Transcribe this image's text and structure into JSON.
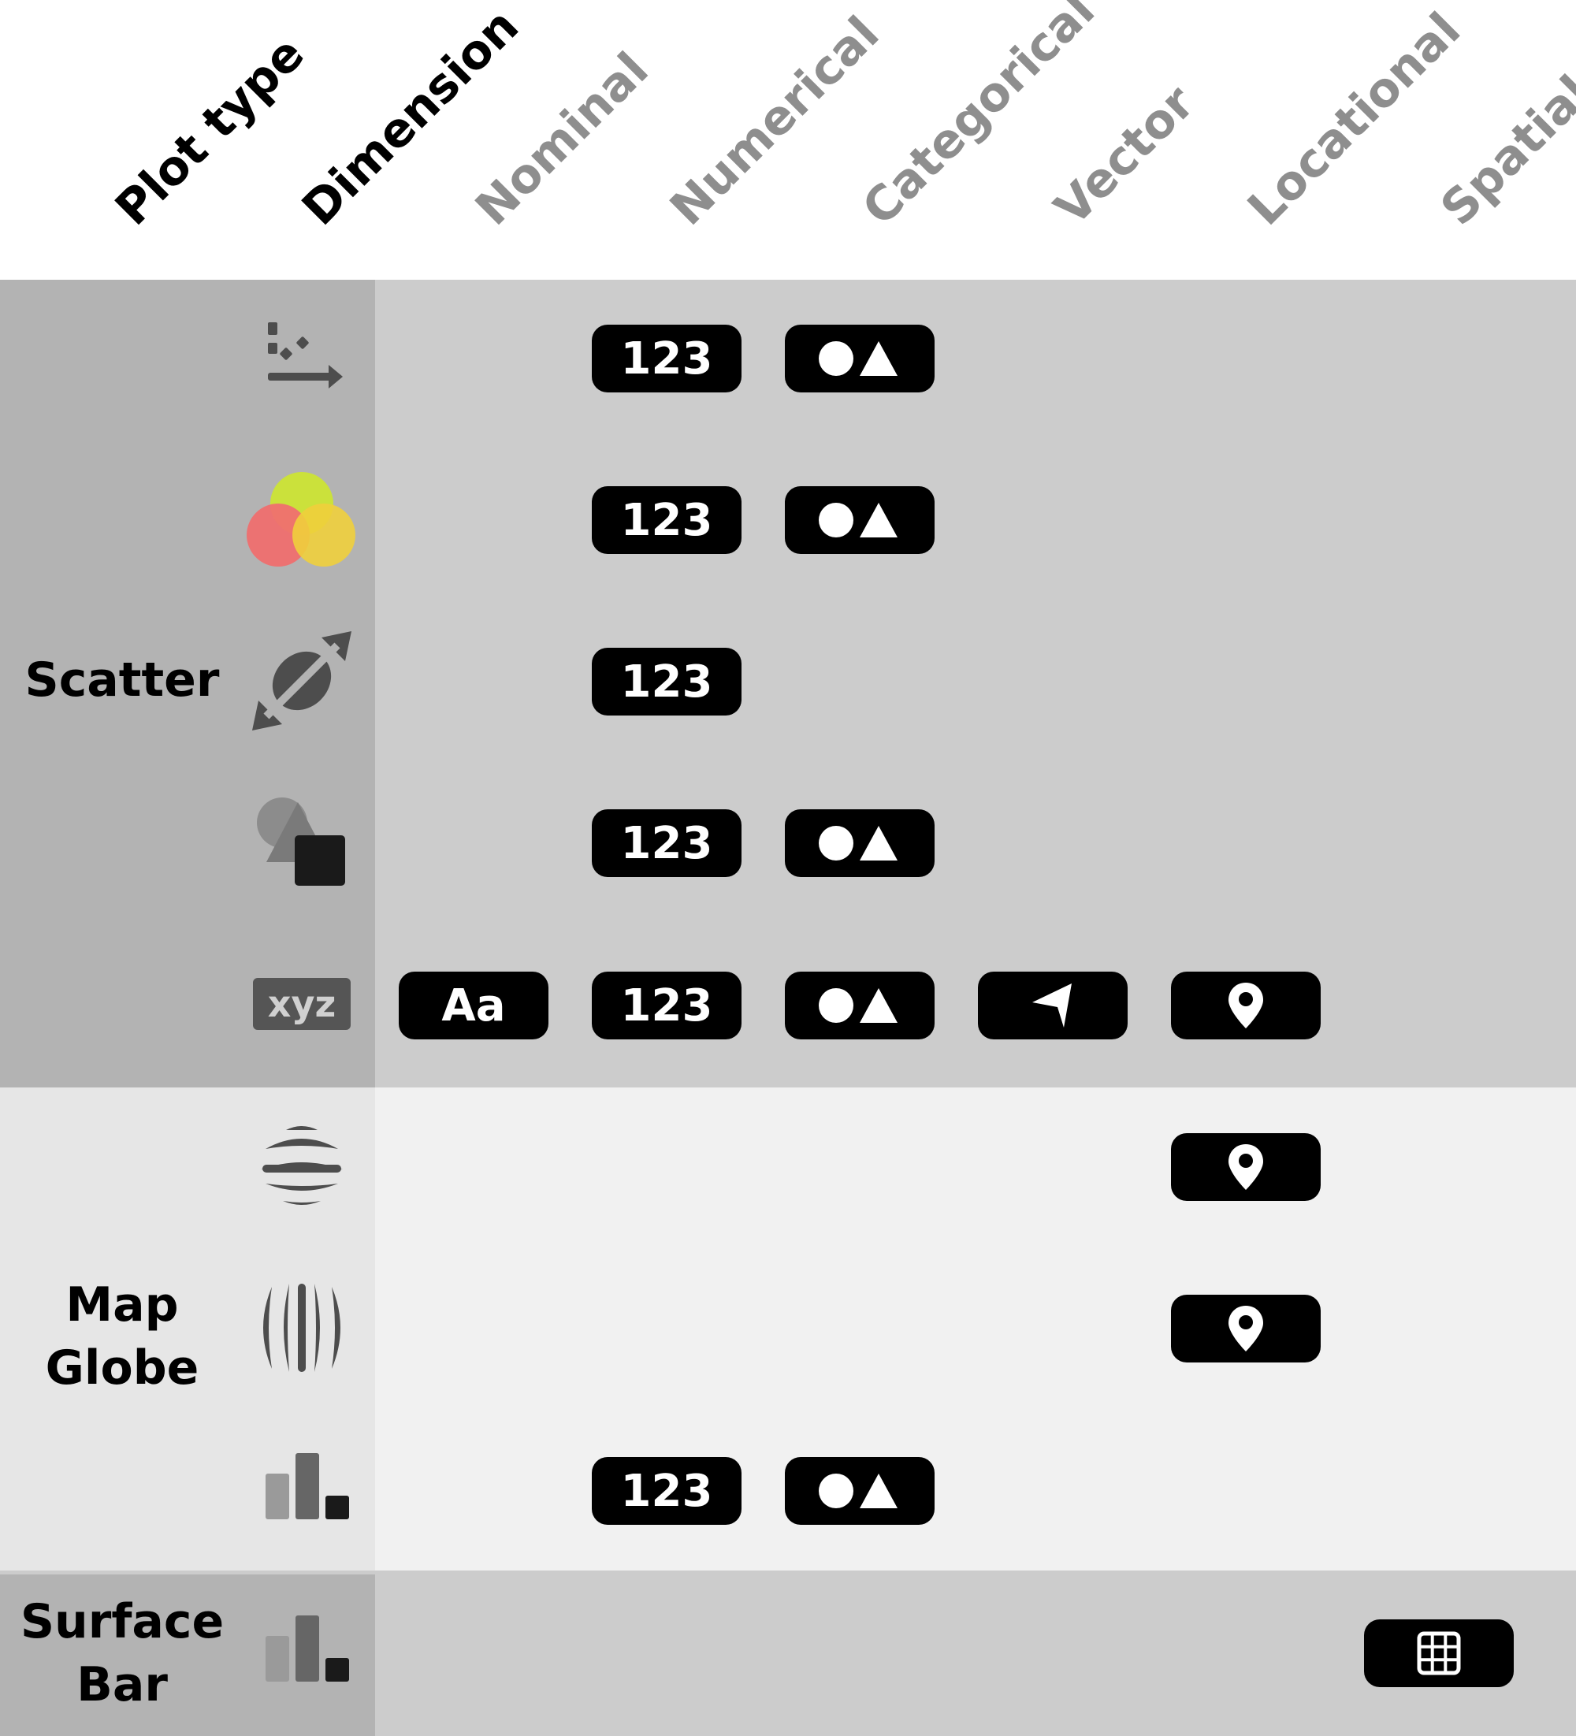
{
  "header": {
    "plot_type_label": "Plot type",
    "dimension_label": "Dimension",
    "columns": [
      "Nominal",
      "Numerical",
      "Categorical",
      "Vector",
      "Locational",
      "Spatial"
    ]
  },
  "groups": [
    {
      "name": "Scatter",
      "lines": [
        "Scatter"
      ],
      "band_color": "#cccccc",
      "panel_color": "#b3b3b3"
    },
    {
      "name": "Map Globe",
      "lines": [
        "Map",
        "Globe"
      ],
      "band_color": "#f1f1f1",
      "panel_color": "#e6e6e6"
    },
    {
      "name": "Surface Bar",
      "lines": [
        "Surface",
        "Bar"
      ],
      "band_color": "#cccccc",
      "panel_color": "#b3b3b3"
    }
  ],
  "rows": [
    {
      "group": "Scatter",
      "icon": "scatter-position-icon",
      "cells": {
        "Numerical": "123",
        "Categorical": "shape-icon"
      }
    },
    {
      "group": "Scatter",
      "icon": "color-circles-icon",
      "cells": {
        "Numerical": "123",
        "Categorical": "shape-icon"
      }
    },
    {
      "group": "Scatter",
      "icon": "size-orientation-icon",
      "cells": {
        "Numerical": "123"
      }
    },
    {
      "group": "Scatter",
      "icon": "shape-encoding-icon",
      "cells": {
        "Numerical": "123",
        "Categorical": "shape-icon"
      }
    },
    {
      "group": "Scatter",
      "icon": "xyz-label-icon",
      "icon_text": "xyz",
      "cells": {
        "Nominal": "Aa",
        "Numerical": "123",
        "Categorical": "shape-icon",
        "Vector": "arrow-icon",
        "Locational": "location-pin-icon"
      }
    },
    {
      "group": "Map Globe",
      "icon": "globe-latitude-icon",
      "cells": {
        "Locational": "location-pin-icon"
      }
    },
    {
      "group": "Map Globe",
      "icon": "globe-longitude-icon",
      "cells": {
        "Locational": "location-pin-icon"
      }
    },
    {
      "group": "Map Globe",
      "icon": "bar-chart-icon",
      "cells": {
        "Numerical": "123",
        "Categorical": "shape-icon"
      }
    },
    {
      "group": "Surface Bar",
      "icon": "bar-chart-icon",
      "cells": {
        "Spatial": "grid-icon"
      }
    }
  ],
  "pill_labels": {
    "nominal": "Aa",
    "numerical": "123"
  },
  "colors": {
    "pill": "#000000",
    "header_dark": "#000000",
    "header_light": "#8e8e8e",
    "band_dark": "#cccccc",
    "band_light": "#f1f1f1",
    "panel_dark": "#b3b3b3",
    "panel_light": "#e6e6e6"
  }
}
